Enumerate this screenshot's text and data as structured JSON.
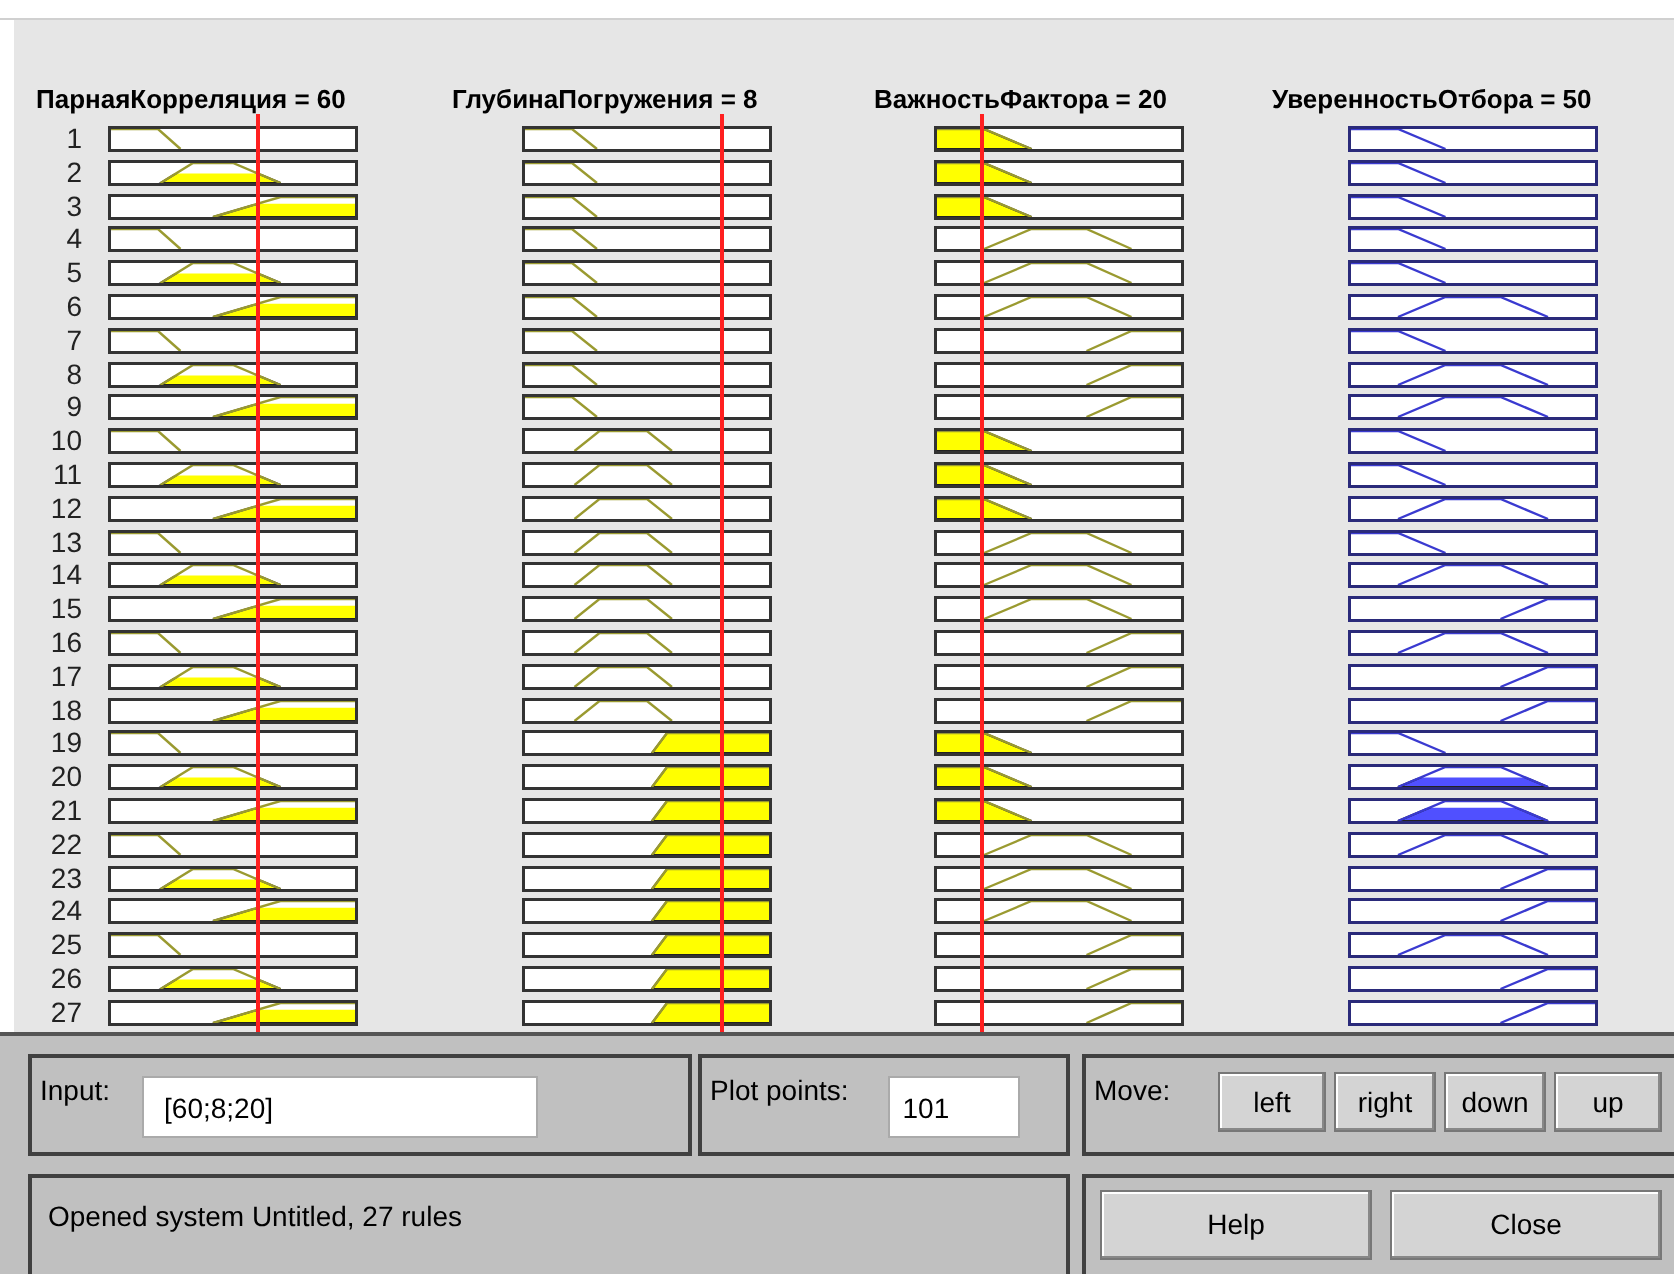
{
  "columns": [
    {
      "kind": "input",
      "title": "ПарнаяКорреляция = 60"
    },
    {
      "kind": "input",
      "title": "ГлубинаПогружения = 8"
    },
    {
      "kind": "input",
      "title": "ВажностьФактора = 20"
    },
    {
      "kind": "output",
      "title": "УверенностьОтбора = 50"
    }
  ],
  "rules": [
    {
      "number": "1",
      "cells": [
        {
          "kind": "low"
        },
        {
          "kind": "low"
        },
        {
          "kind": "low"
        },
        {
          "kind": "low"
        }
      ]
    },
    {
      "number": "2",
      "cells": [
        {
          "kind": "mid"
        },
        {
          "kind": "low"
        },
        {
          "kind": "low"
        },
        {
          "kind": "low"
        }
      ]
    },
    {
      "number": "3",
      "cells": [
        {
          "kind": "high"
        },
        {
          "kind": "low"
        },
        {
          "kind": "low"
        },
        {
          "kind": "low"
        }
      ]
    },
    {
      "number": "4",
      "cells": [
        {
          "kind": "low"
        },
        {
          "kind": "low"
        },
        {
          "kind": "mid"
        },
        {
          "kind": "low"
        }
      ]
    },
    {
      "number": "5",
      "cells": [
        {
          "kind": "mid"
        },
        {
          "kind": "low"
        },
        {
          "kind": "mid"
        },
        {
          "kind": "low"
        }
      ]
    },
    {
      "number": "6",
      "cells": [
        {
          "kind": "high"
        },
        {
          "kind": "low"
        },
        {
          "kind": "mid"
        },
        {
          "kind": "mid"
        }
      ]
    },
    {
      "number": "7",
      "cells": [
        {
          "kind": "low"
        },
        {
          "kind": "low"
        },
        {
          "kind": "high"
        },
        {
          "kind": "low"
        }
      ]
    },
    {
      "number": "8",
      "cells": [
        {
          "kind": "mid"
        },
        {
          "kind": "low"
        },
        {
          "kind": "high"
        },
        {
          "kind": "mid"
        }
      ]
    },
    {
      "number": "9",
      "cells": [
        {
          "kind": "high"
        },
        {
          "kind": "low"
        },
        {
          "kind": "high"
        },
        {
          "kind": "mid"
        }
      ]
    },
    {
      "number": "10",
      "cells": [
        {
          "kind": "low"
        },
        {
          "kind": "mid"
        },
        {
          "kind": "low"
        },
        {
          "kind": "low"
        }
      ]
    },
    {
      "number": "11",
      "cells": [
        {
          "kind": "mid"
        },
        {
          "kind": "mid"
        },
        {
          "kind": "low"
        },
        {
          "kind": "low"
        }
      ]
    },
    {
      "number": "12",
      "cells": [
        {
          "kind": "high"
        },
        {
          "kind": "mid"
        },
        {
          "kind": "low"
        },
        {
          "kind": "mid"
        }
      ]
    },
    {
      "number": "13",
      "cells": [
        {
          "kind": "low"
        },
        {
          "kind": "mid"
        },
        {
          "kind": "mid"
        },
        {
          "kind": "low"
        }
      ]
    },
    {
      "number": "14",
      "cells": [
        {
          "kind": "mid"
        },
        {
          "kind": "mid"
        },
        {
          "kind": "mid"
        },
        {
          "kind": "mid"
        }
      ]
    },
    {
      "number": "15",
      "cells": [
        {
          "kind": "high"
        },
        {
          "kind": "mid"
        },
        {
          "kind": "mid"
        },
        {
          "kind": "high"
        }
      ]
    },
    {
      "number": "16",
      "cells": [
        {
          "kind": "low"
        },
        {
          "kind": "mid"
        },
        {
          "kind": "high"
        },
        {
          "kind": "mid"
        }
      ]
    },
    {
      "number": "17",
      "cells": [
        {
          "kind": "mid"
        },
        {
          "kind": "mid"
        },
        {
          "kind": "high"
        },
        {
          "kind": "high"
        }
      ]
    },
    {
      "number": "18",
      "cells": [
        {
          "kind": "high"
        },
        {
          "kind": "mid"
        },
        {
          "kind": "high"
        },
        {
          "kind": "high"
        }
      ]
    },
    {
      "number": "19",
      "cells": [
        {
          "kind": "low"
        },
        {
          "kind": "high"
        },
        {
          "kind": "low"
        },
        {
          "kind": "low"
        }
      ]
    },
    {
      "number": "20",
      "cells": [
        {
          "kind": "mid"
        },
        {
          "kind": "high"
        },
        {
          "kind": "low"
        },
        {
          "kind": "mid"
        }
      ]
    },
    {
      "number": "21",
      "cells": [
        {
          "kind": "high"
        },
        {
          "kind": "high"
        },
        {
          "kind": "low"
        },
        {
          "kind": "mid"
        }
      ]
    },
    {
      "number": "22",
      "cells": [
        {
          "kind": "low"
        },
        {
          "kind": "high"
        },
        {
          "kind": "mid"
        },
        {
          "kind": "mid"
        }
      ]
    },
    {
      "number": "23",
      "cells": [
        {
          "kind": "mid"
        },
        {
          "kind": "high"
        },
        {
          "kind": "mid"
        },
        {
          "kind": "high"
        }
      ]
    },
    {
      "number": "24",
      "cells": [
        {
          "kind": "high"
        },
        {
          "kind": "high"
        },
        {
          "kind": "mid"
        },
        {
          "kind": "high"
        }
      ]
    },
    {
      "number": "25",
      "cells": [
        {
          "kind": "low"
        },
        {
          "kind": "high"
        },
        {
          "kind": "high"
        },
        {
          "kind": "mid"
        }
      ]
    },
    {
      "number": "26",
      "cells": [
        {
          "kind": "mid"
        },
        {
          "kind": "high"
        },
        {
          "kind": "high"
        },
        {
          "kind": "high"
        }
      ]
    },
    {
      "number": "27",
      "cells": [
        {
          "kind": "high"
        },
        {
          "kind": "high"
        },
        {
          "kind": "high"
        },
        {
          "kind": "high"
        }
      ]
    }
  ],
  "input": {
    "label": "Input:",
    "value": "[60;8;20]"
  },
  "plot_points": {
    "label": "Plot points:",
    "value": "101"
  },
  "move": {
    "label": "Move:",
    "buttons": [
      "left",
      "right",
      "down",
      "up"
    ]
  },
  "status": "Opened system Untitled, 27 rules",
  "buttons": [
    "Help",
    "Close"
  ]
}
